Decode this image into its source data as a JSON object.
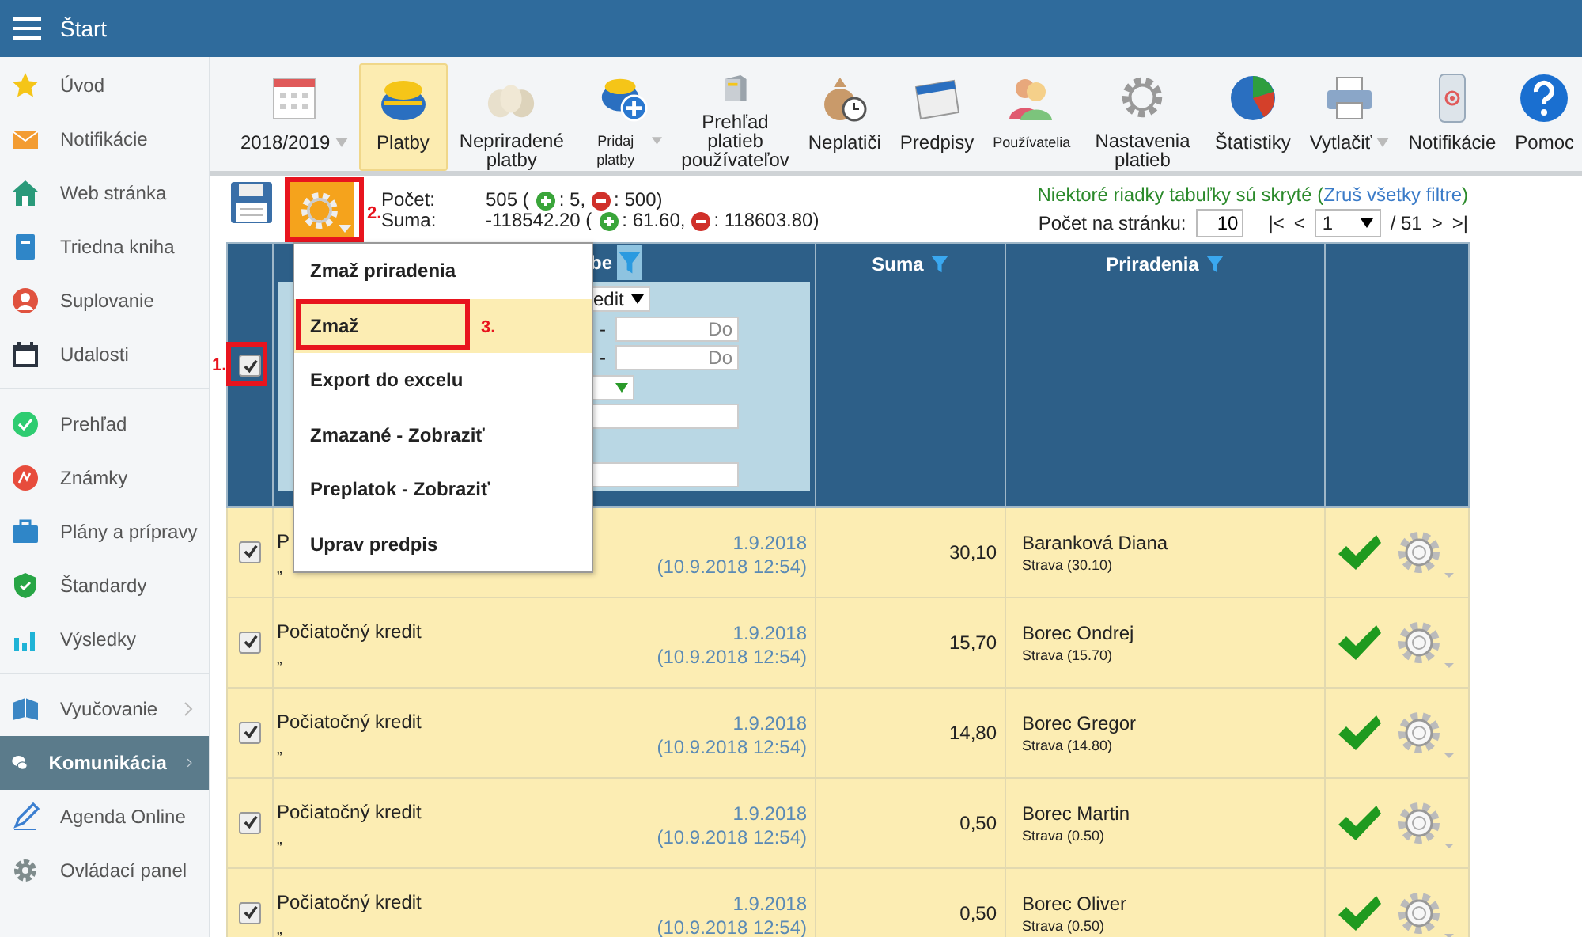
{
  "top_bar": {
    "title": "Štart"
  },
  "sidebar": {
    "groups": [
      [
        {
          "label": "Úvod",
          "selected": false,
          "has_submenu": false
        },
        {
          "label": "Notifikácie",
          "selected": false,
          "has_submenu": false
        },
        {
          "label": "Web stránka",
          "selected": false,
          "has_submenu": false
        },
        {
          "label": "Triedna kniha",
          "selected": false,
          "has_submenu": false
        },
        {
          "label": "Suplovanie",
          "selected": false,
          "has_submenu": false
        },
        {
          "label": "Udalosti",
          "selected": false,
          "has_submenu": false
        }
      ],
      [
        {
          "label": "Prehľad",
          "selected": false,
          "has_submenu": false
        },
        {
          "label": "Známky",
          "selected": false,
          "has_submenu": false
        },
        {
          "label": "Plány a prípravy",
          "selected": false,
          "has_submenu": false
        },
        {
          "label": "Štandardy",
          "selected": false,
          "has_submenu": false
        },
        {
          "label": "Výsledky",
          "selected": false,
          "has_submenu": false
        }
      ],
      [
        {
          "label": "Vyučovanie",
          "selected": false,
          "has_submenu": true
        },
        {
          "label": "Komunikácia",
          "selected": true,
          "has_submenu": true
        },
        {
          "label": "Agenda Online",
          "selected": false,
          "has_submenu": false
        },
        {
          "label": "Ovládací panel",
          "selected": false,
          "has_submenu": false
        }
      ]
    ]
  },
  "toolbar": [
    {
      "label": "2018/2019",
      "selected": false,
      "dropdown": true,
      "compact": false
    },
    {
      "label": "Platby",
      "selected": true,
      "dropdown": false,
      "compact": false
    },
    {
      "label": "Nepriradené platby",
      "selected": false,
      "dropdown": false,
      "compact": false
    },
    {
      "label": "Pridaj platby",
      "selected": false,
      "dropdown": true,
      "compact": true
    },
    {
      "label": "Prehľad platieb používateľov",
      "selected": false,
      "dropdown": false,
      "compact": false
    },
    {
      "label": "Neplatiči",
      "selected": false,
      "dropdown": false,
      "compact": false
    },
    {
      "label": "Predpisy",
      "selected": false,
      "dropdown": false,
      "compact": false
    },
    {
      "label": "Používatelia",
      "selected": false,
      "dropdown": false,
      "compact": true
    },
    {
      "label": "Nastavenia platieb",
      "selected": false,
      "dropdown": false,
      "compact": false
    },
    {
      "label": "Štatistiky",
      "selected": false,
      "dropdown": false,
      "compact": false
    },
    {
      "label": "Vytlačiť",
      "selected": false,
      "dropdown": true,
      "compact": false
    },
    {
      "label": "Notifikácie",
      "selected": false,
      "dropdown": false,
      "compact": false
    },
    {
      "label": "Pomoc",
      "selected": false,
      "dropdown": false,
      "compact": false
    }
  ],
  "summary": [
    {
      "label": "Počet:",
      "total": "505 (",
      "plus": ": 5,",
      "minus": ": 500)"
    },
    {
      "label": "Suma:",
      "total": "-118542.20 (",
      "plus": ": 61.60,",
      "minus": ": 118603.80)"
    }
  ],
  "filter_notice": {
    "text": "Niektoré riadky tabuľky sú skryté (",
    "link": "Zruš všetky filtre",
    "end": ")"
  },
  "pagination": {
    "per_page_label": "Počet na stránku:",
    "per_page": "10",
    "first": "|<",
    "prev": "<",
    "page": "1",
    "total": "/ 51",
    "next": ">",
    "last": ">|"
  },
  "menu": [
    {
      "label": "Zmaž priradenia",
      "selected": false
    },
    {
      "label": "Zmaž",
      "selected": true
    },
    {
      "label": "Export do excelu",
      "selected": false
    },
    {
      "label": "Zmazané - Zobraziť",
      "selected": false
    },
    {
      "label": "Preplatok - Zobraziť",
      "selected": false
    },
    {
      "label": "Uprav predpis",
      "selected": false
    }
  ],
  "annotations": [
    "1.",
    "2.",
    "3."
  ],
  "table": {
    "select_all_checked": true,
    "description_header": "be",
    "filter_panel": {
      "type_select": "edit",
      "ranges": [
        {
          "separator": "-",
          "placeholder": "Do"
        },
        {
          "separator": "-",
          "placeholder": "Do"
        }
      ]
    },
    "columns": [
      "Suma",
      "Priradenia"
    ],
    "rows": [
      {
        "checked": true,
        "title": "P",
        "note": "„",
        "date": "1.9.2018",
        "time": "(10.9.2018 12:54)",
        "amount": "30,10",
        "name": "Baranková Diana",
        "detail": "Strava (30.10)"
      },
      {
        "checked": true,
        "title": "Počiatočný kredit",
        "note": "„",
        "date": "1.9.2018",
        "time": "(10.9.2018 12:54)",
        "amount": "15,70",
        "name": "Borec Ondrej",
        "detail": "Strava (15.70)"
      },
      {
        "checked": true,
        "title": "Počiatočný kredit",
        "note": "„",
        "date": "1.9.2018",
        "time": "(10.9.2018 12:54)",
        "amount": "14,80",
        "name": "Borec Gregor",
        "detail": "Strava (14.80)"
      },
      {
        "checked": true,
        "title": "Počiatočný kredit",
        "note": "„",
        "date": "1.9.2018",
        "time": "(10.9.2018 12:54)",
        "amount": "0,50",
        "name": "Borec Martin",
        "detail": "Strava (0.50)"
      },
      {
        "checked": true,
        "title": "Počiatočný kredit",
        "note": "„",
        "date": "1.9.2018",
        "time": "(10.9.2018 12:54)",
        "amount": "0,50",
        "name": "Borec Oliver",
        "detail": "Strava (0.50)"
      }
    ]
  }
}
